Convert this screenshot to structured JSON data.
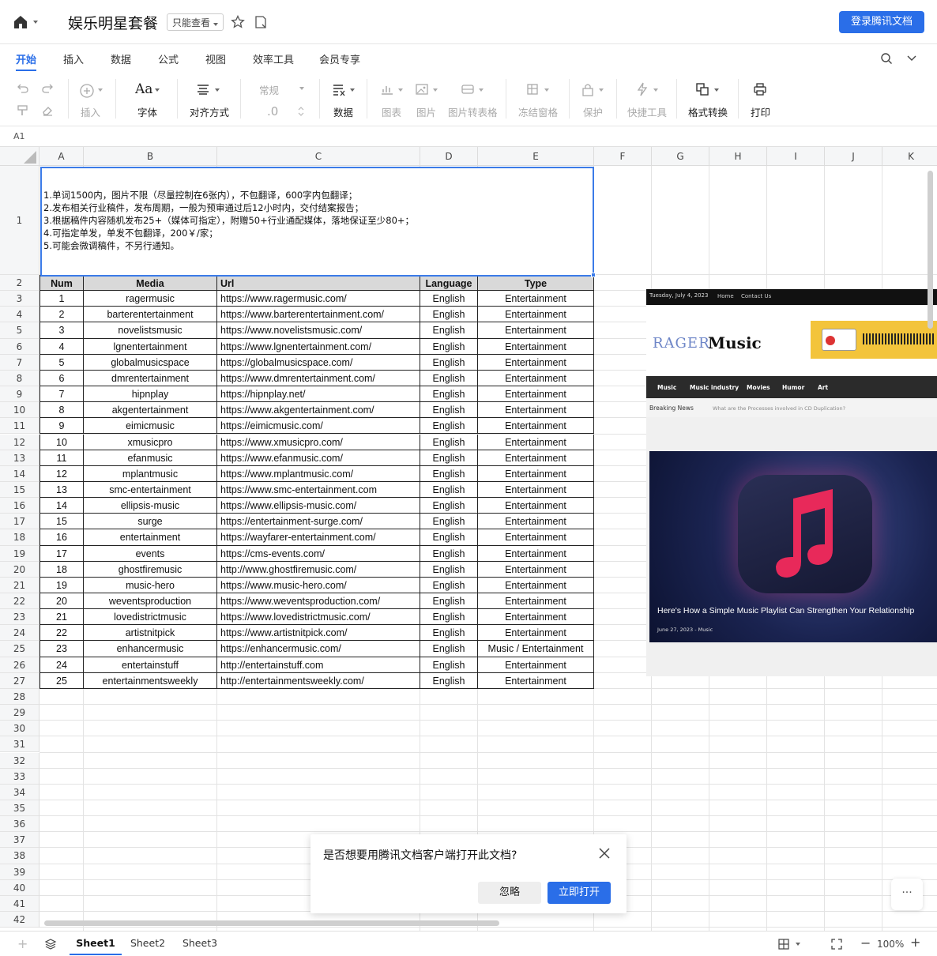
{
  "header": {
    "title": "娱乐明星套餐",
    "mode_badge": "只能查看",
    "login_button": "登录腾讯文档"
  },
  "tabs": [
    "开始",
    "插入",
    "数据",
    "公式",
    "视图",
    "效率工具",
    "会员专享"
  ],
  "toolbar": {
    "insert": "插入",
    "font": "字体",
    "align": "对齐方式",
    "number_format": "常规",
    "decimal": ".0",
    "data": "数据",
    "chart": "图表",
    "image": "图片",
    "image_to_table": "图片转表格",
    "freeze": "冻结窗格",
    "protect": "保护",
    "quick_tools": "快捷工具",
    "format_convert": "格式转换",
    "print": "打印"
  },
  "cell_ref": "A1",
  "columns": [
    "A",
    "B",
    "C",
    "D",
    "E",
    "F",
    "G",
    "H",
    "I",
    "J",
    "K"
  ],
  "note_lines": [
    "1.单词1500内，图片不限（尽量控制在6张内），不包翻译，600字内包翻译；",
    "2.发布相关行业稿件，发布周期，一般为预审通过后12小时内，交付结案报告；",
    "3.根据稿件内容随机发布25+（媒体可指定），附赠50+行业通配媒体，落地保证至少80+；",
    "4.可指定单发，单发不包翻译，200￥/家；",
    "5.可能会微调稿件，不另行通知。"
  ],
  "table_headers": [
    "Num",
    "Media",
    "Url",
    "Language",
    "Type"
  ],
  "table_rows": [
    [
      "1",
      "ragermusic",
      "https://www.ragermusic.com/",
      "English",
      "Entertainment"
    ],
    [
      "2",
      "barterentertainment",
      "https://www.barterentertainment.com/",
      "English",
      "Entertainment"
    ],
    [
      "3",
      "novelistsmusic",
      "https://www.novelistsmusic.com/",
      "English",
      "Entertainment"
    ],
    [
      "4",
      "lgnentertainment",
      "https://www.lgnentertainment.com/",
      "English",
      "Entertainment"
    ],
    [
      "5",
      "globalmusicspace",
      "https://globalmusicspace.com/",
      "English",
      "Entertainment"
    ],
    [
      "6",
      "dmrentertainment",
      "https://www.dmrentertainment.com/",
      "English",
      "Entertainment"
    ],
    [
      "7",
      "hipnplay",
      "https://hipnplay.net/",
      "English",
      "Entertainment"
    ],
    [
      "8",
      "akgentertainment",
      "https://www.akgentertainment.com/",
      "English",
      "Entertainment"
    ],
    [
      "9",
      "eimicmusic",
      "https://eimicmusic.com/",
      "English",
      "Entertainment"
    ],
    [
      "10",
      "xmusicpro",
      "https://www.xmusicpro.com/",
      "English",
      "Entertainment"
    ],
    [
      "11",
      "efanmusic",
      "https://www.efanmusic.com/",
      "English",
      "Entertainment"
    ],
    [
      "12",
      "mplantmusic",
      "https://www.mplantmusic.com/",
      "English",
      "Entertainment"
    ],
    [
      "13",
      "smc-entertainment",
      "https://www.smc-entertainment.com",
      "English",
      "Entertainment"
    ],
    [
      "14",
      "ellipsis-music",
      "https://www.ellipsis-music.com/",
      "English",
      "Entertainment"
    ],
    [
      "15",
      "surge",
      "https://entertainment-surge.com/",
      "English",
      "Entertainment"
    ],
    [
      "16",
      "entertainment",
      "https://wayfarer-entertainment.com/",
      "English",
      "Entertainment"
    ],
    [
      "17",
      "events",
      "https://cms-events.com/",
      "English",
      "Entertainment"
    ],
    [
      "18",
      "ghostfiremusic",
      "http://www.ghostfiremusic.com/",
      "English",
      "Entertainment"
    ],
    [
      "19",
      "music-hero",
      "https://www.music-hero.com/",
      "English",
      "Entertainment"
    ],
    [
      "20",
      "weventsproduction",
      "https://www.weventsproduction.com/",
      "English",
      "Entertainment"
    ],
    [
      "21",
      "lovedistrictmusic",
      "https://www.lovedistrictmusic.com/",
      "English",
      "Entertainment"
    ],
    [
      "22",
      "artistnitpick",
      "https://www.artistnitpick.com/",
      "English",
      "Entertainment"
    ],
    [
      "23",
      "enhancermusic",
      "https://enhancermusic.com/",
      "English",
      "Music / Entertainment"
    ],
    [
      "24",
      "entertainstuff",
      "http://entertainstuff.com",
      "English",
      "Entertainment"
    ],
    [
      "25",
      "entertainmentsweekly",
      "http://entertainmentsweekly.com/",
      "English",
      "Entertainment"
    ]
  ],
  "row_numbers": [
    "1",
    "2",
    "3",
    "4",
    "5",
    "6",
    "7",
    "8",
    "9",
    "10",
    "11",
    "12",
    "13",
    "14",
    "15",
    "16",
    "17",
    "18",
    "19",
    "20",
    "21",
    "22",
    "23",
    "24",
    "25",
    "26",
    "27",
    "28",
    "29",
    "30",
    "31",
    "32",
    "33",
    "34",
    "35",
    "36",
    "37",
    "38",
    "39",
    "40",
    "41",
    "42"
  ],
  "screenshot": {
    "date": "Tuesday, July 4, 2023",
    "nav_top": [
      "Home",
      "Contact Us"
    ],
    "logo_a": "RAGER",
    "logo_b": "Music",
    "menu": [
      "Music",
      "Music industry",
      "Movies",
      "Humor",
      "Art"
    ],
    "breaking_label": "Breaking News",
    "breaking_text": "What are the Processes involved in CD Duplication?",
    "headline": "Here's How a Simple Music Playlist Can Strengthen Your Relationship",
    "meta": "June 27, 2023 - Music"
  },
  "dialog": {
    "message": "是否想要用腾讯文档客户端打开此文档?",
    "ignore": "忽略",
    "open": "立即打开"
  },
  "sheets": [
    "Sheet1",
    "Sheet2",
    "Sheet3"
  ],
  "zoom": "100%",
  "colors": {
    "accent": "#2a6ee8"
  }
}
